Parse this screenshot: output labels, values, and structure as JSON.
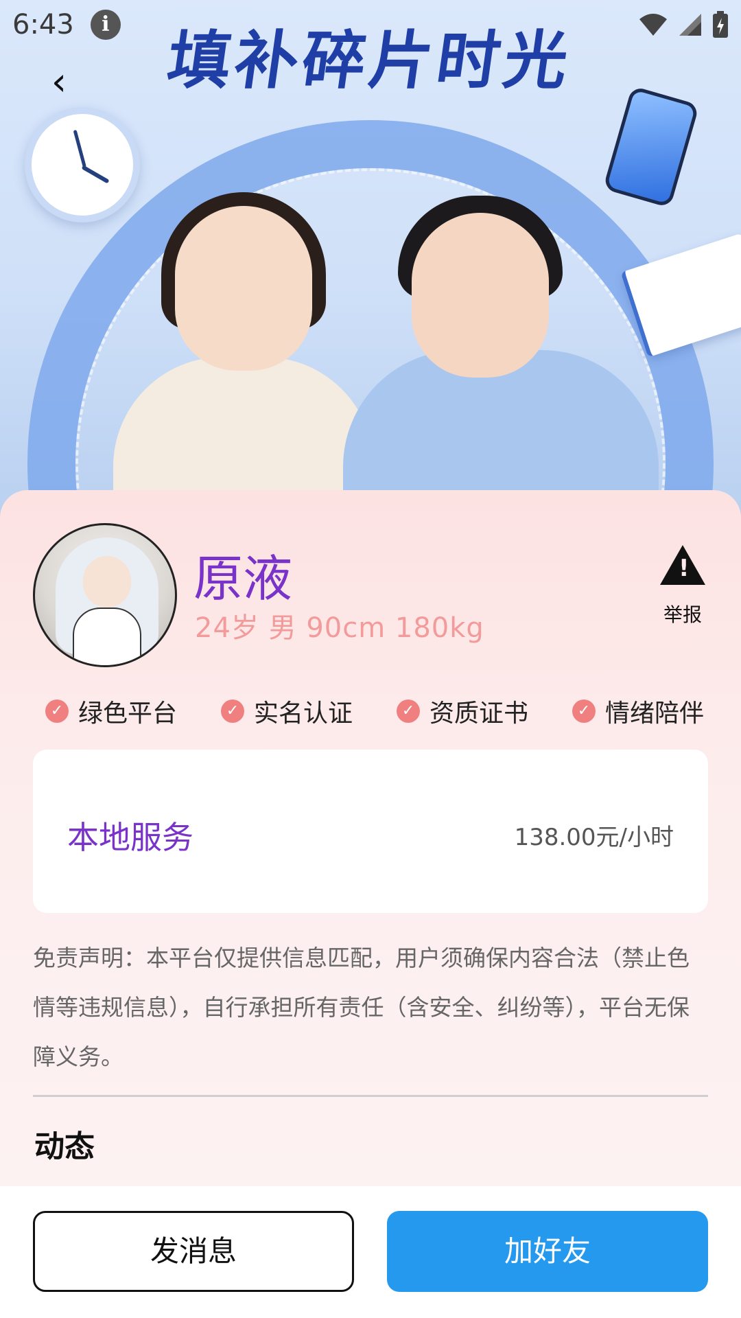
{
  "status_bar": {
    "time": "6:43"
  },
  "hero": {
    "title": "填补碎片时光"
  },
  "profile": {
    "name": "原液",
    "meta": "24岁 男 90cm 180kg",
    "report_label": "举报"
  },
  "badges": [
    "绿色平台",
    "实名认证",
    "资质证书",
    "情绪陪伴"
  ],
  "service": {
    "name": "本地服务",
    "price": "138.00元/小时"
  },
  "disclaimer": "免责声明：本平台仅提供信息匹配，用户须确保内容合法（禁止色情等违规信息），自行承担所有责任（含安全、纠纷等），平台无保障义务。",
  "section": {
    "title": "动态"
  },
  "actions": {
    "message": "发消息",
    "add_friend": "加好友"
  },
  "colors": {
    "name": "#7a33c9",
    "meta": "#f39a9a",
    "primary_button": "#2499ee",
    "check": "#f08080"
  }
}
